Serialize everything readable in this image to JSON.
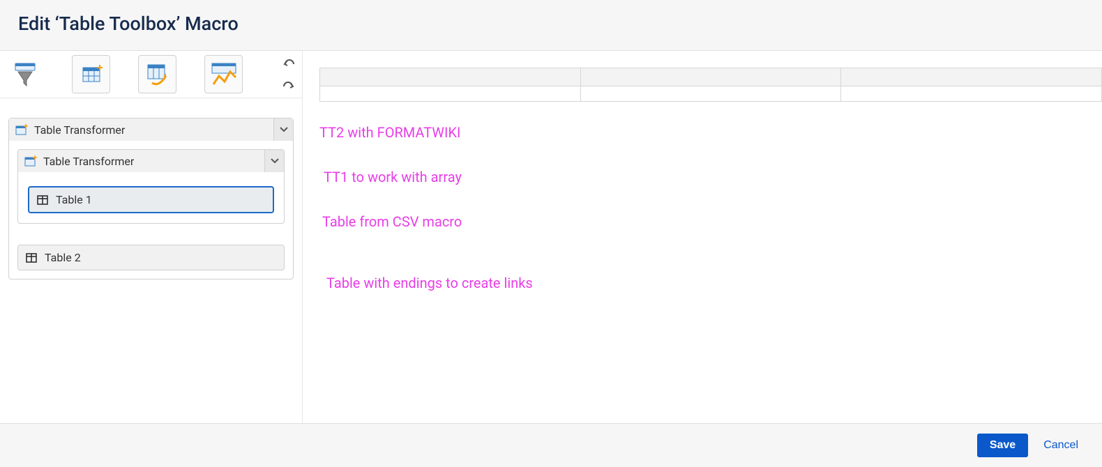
{
  "header": {
    "title": "Edit ‘Table Toolbox’ Macro"
  },
  "toolbar": {
    "icons": [
      "filter",
      "transformer",
      "pivot",
      "chart"
    ],
    "undo": "undo",
    "redo": "redo"
  },
  "tree": {
    "outer": {
      "label": "Table Transformer",
      "inner": {
        "label": "Table Transformer",
        "table": "Table 1"
      },
      "table2": "Table 2"
    }
  },
  "annotations": [
    "TT2 with FORMATWIKI",
    "TT1 to work with array",
    "Table from CSV macro",
    "Table with endings to create links"
  ],
  "footer": {
    "save": "Save",
    "cancel": "Cancel"
  },
  "colors": {
    "accent": "#0a58ca",
    "annotation": "#e83ee8"
  }
}
